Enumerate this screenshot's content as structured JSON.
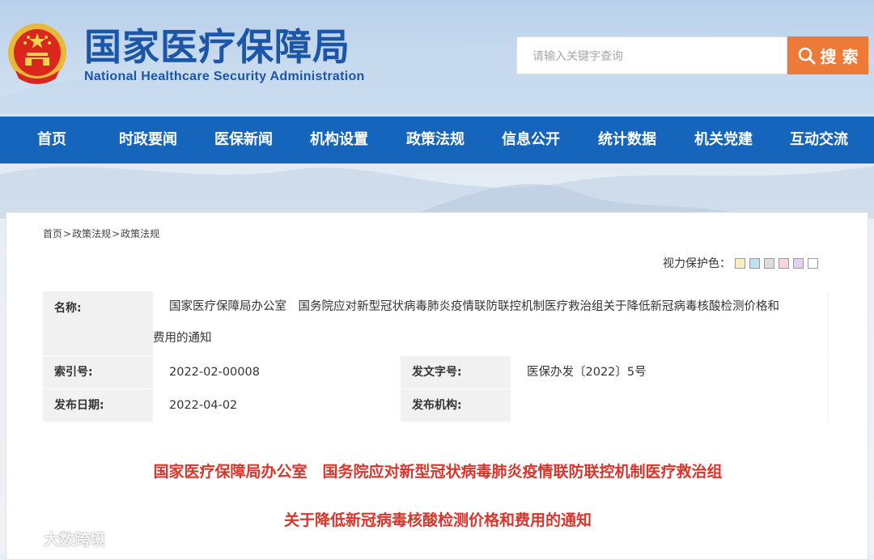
{
  "header": {
    "logo_cn": "国家医疗保障局",
    "logo_en": "National Healthcare Security Administration",
    "search_placeholder": "请输入关键字查询",
    "search_button": "搜 索"
  },
  "nav": [
    "首页",
    "时政要闻",
    "医保新闻",
    "机构设置",
    "政策法规",
    "信息公开",
    "统计数据",
    "机关党建",
    "互动交流"
  ],
  "breadcrumb": [
    "首页",
    "政策法规",
    "政策法规"
  ],
  "breadcrumb_sep": ">",
  "vision": {
    "label": "视力保护色：",
    "swatches": [
      "#f7f1bd",
      "#bfe3f1",
      "#dcdcdc",
      "#f5d7dd",
      "#e4d0f1",
      "#ffffff"
    ]
  },
  "meta": {
    "name_label": "名称:",
    "name_value_1": "国家医疗保障局办公室　国务院应对新型冠状病毒肺炎疫情联防联控机制医疗救治组关于降低新冠病毒核酸检测价格和",
    "name_value_2": "费用的通知",
    "index_label": "索引号:",
    "index_value": "2022-02-00008",
    "docno_label": "发文字号:",
    "docno_value": "医保办发〔2022〕5号",
    "date_label": "发布日期:",
    "date_value": "2022-04-02",
    "org_label": "发布机构:",
    "org_value": ""
  },
  "article": {
    "title_line1": "国家医疗保障局办公室　国务院应对新型冠状病毒肺炎疫情联防联控机制医疗救治组",
    "title_line2": "关于降低新冠病毒核酸检测价格和费用的通知"
  },
  "watermark": "大数跨境",
  "colors": {
    "nav": "#1665bc",
    "brand": "#1b56a8",
    "accent": "#ee7a37",
    "title": "#d7362c"
  }
}
